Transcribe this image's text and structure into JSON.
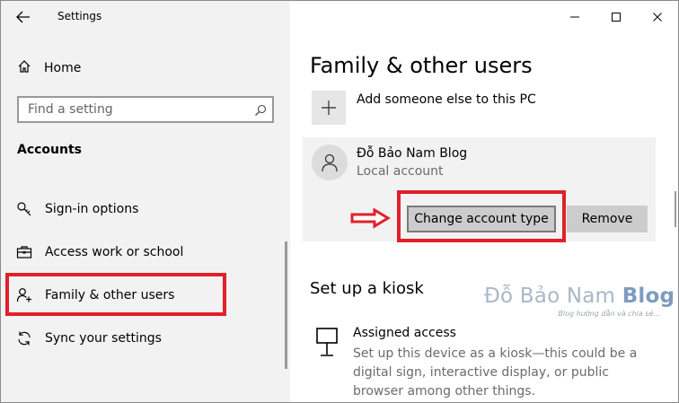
{
  "window": {
    "title": "Settings"
  },
  "sidebar": {
    "home_label": "Home",
    "search": {
      "placeholder": "Find a setting"
    },
    "section_heading": "Accounts",
    "items": [
      {
        "label": "Sign-in options",
        "icon": "key-icon"
      },
      {
        "label": "Access work or school",
        "icon": "briefcase-icon"
      },
      {
        "label": "Family & other users",
        "icon": "add-person-icon"
      },
      {
        "label": "Sync your settings",
        "icon": "sync-icon"
      }
    ]
  },
  "main": {
    "page_title": "Family & other users",
    "add_label": "Add someone else to this PC",
    "user": {
      "name": "Đỗ Bảo Nam Blog",
      "account_type": "Local account",
      "change_label": "Change account type",
      "remove_label": "Remove"
    },
    "kiosk": {
      "title": "Set up a kiosk",
      "heading": "Assigned access",
      "description": "Set up this device as a kiosk—this could be a digital sign, interactive display, or public browser among other things."
    }
  },
  "watermark": {
    "name_part": "Đỗ Bảo Nam",
    "blog_part": "Blog",
    "tagline": "Blog hướng dẫn và chia sẻ..."
  },
  "colors": {
    "highlight": "#e0202a",
    "sidebar_bg": "#f2f2f2",
    "button_bg": "#cccccc"
  }
}
